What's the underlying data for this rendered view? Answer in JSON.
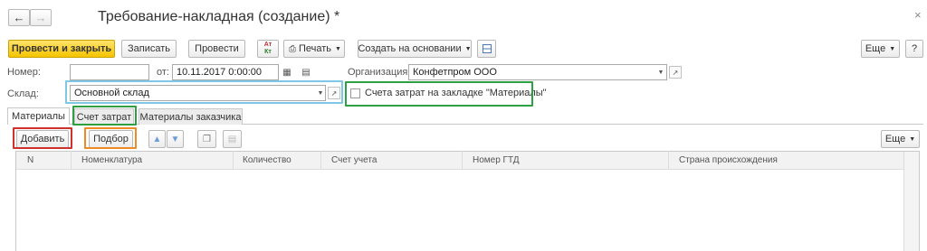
{
  "header": {
    "title": "Требование-накладная (создание) *",
    "help_symbol": "?"
  },
  "toolbar": {
    "post_close": "Провести и закрыть",
    "save": "Записать",
    "post": "Провести",
    "dtkt_top": "Ат",
    "dtkt_bottom": "Кт",
    "print": "Печать",
    "create_based": "Создать на основании",
    "more": "Еще"
  },
  "form": {
    "number_label": "Номер:",
    "number_value": "",
    "date_label": "от:",
    "date_value": "10.11.2017  0:00:00",
    "org_label": "Организация:",
    "org_value": "Конфетпром ООО",
    "warehouse_label": "Склад:",
    "warehouse_value": "Основной склад",
    "checkbox_label": "Счета затрат на закладке \"Материалы\"",
    "checkbox_checked": false
  },
  "tabs": [
    {
      "label": "Материалы",
      "active": true
    },
    {
      "label": "Счет затрат",
      "active": false
    },
    {
      "label": "Материалы заказчика",
      "active": false
    }
  ],
  "table_toolbar": {
    "add": "Добавить",
    "select": "Подбор",
    "more": "Еще"
  },
  "table": {
    "columns": [
      "N",
      "Номенклатура",
      "Количество",
      "Счет учета",
      "Номер ГТД",
      "Страна происхождения"
    ],
    "rows": []
  },
  "colors": {
    "primary_button": "#f5c400",
    "highlight_warehouse": "#7ec8e3",
    "highlight_checkbox": "#2ea043",
    "highlight_tab": "#2ea043",
    "highlight_add": "#d0312d",
    "highlight_select": "#f08a24"
  }
}
